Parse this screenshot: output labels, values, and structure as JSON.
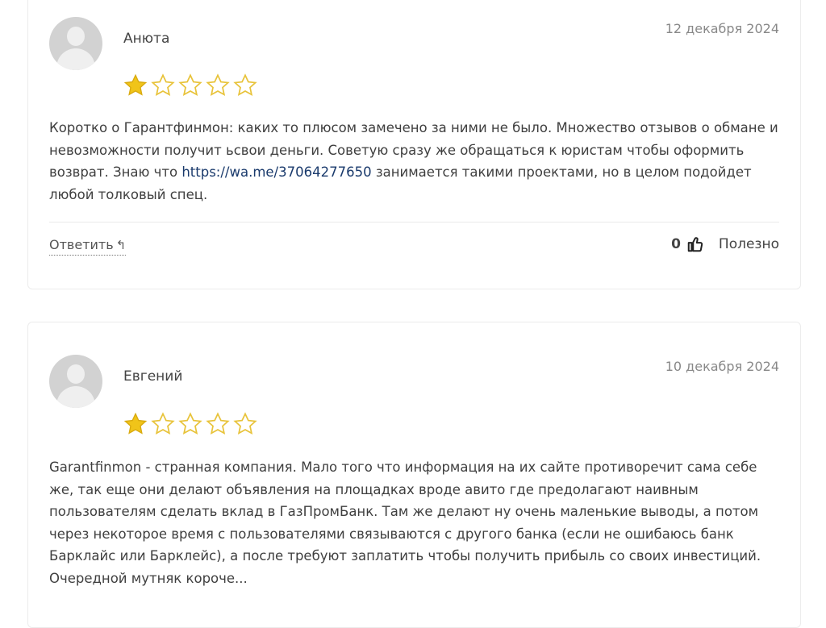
{
  "reviews": [
    {
      "author": "Анюта",
      "date": "12 декабря 2024",
      "rating": 1,
      "rating_max": 5,
      "text_before_link": "Коротко о Гарантфинмон: каких то плюсом замечено за ними не было. Множество отзывов о обмане и невозможности получит ьсвои деньги. Советую сразу же обращаться к юристам чтобы оформить возврат. Знаю что ",
      "link_text": "https://wa.me/37064277650",
      "text_after_link": " занимается такими проектами, но в целом подойдет любой толковый спец.",
      "reply_label": "Ответить",
      "reply_icon": "↰",
      "useful_count": "0",
      "useful_label": "Полезно"
    },
    {
      "author": "Евгений",
      "date": "10 декабря 2024",
      "rating": 1,
      "rating_max": 5,
      "text": "Garantfinmon - странная компания. Мало того что информация на их сайте противоречит сама себе же, так еще они делают объявления на площадках вроде авито где предолагают наивным пользователям сделать вклад в ГазПромБанк. Там же делают ну очень маленькие выводы, а потом через некоторое время с пользователями связываются с другого банка (если не ошибаюсь банк Барклайс или Барклейс), а после требуют заплатить чтобы получить прибыль со своих инвестиций. Очередной мутняк короче..."
    }
  ],
  "colors": {
    "star_filled": "#f0c419",
    "star_empty": "#e8c33a",
    "link": "#1a3a6c"
  }
}
